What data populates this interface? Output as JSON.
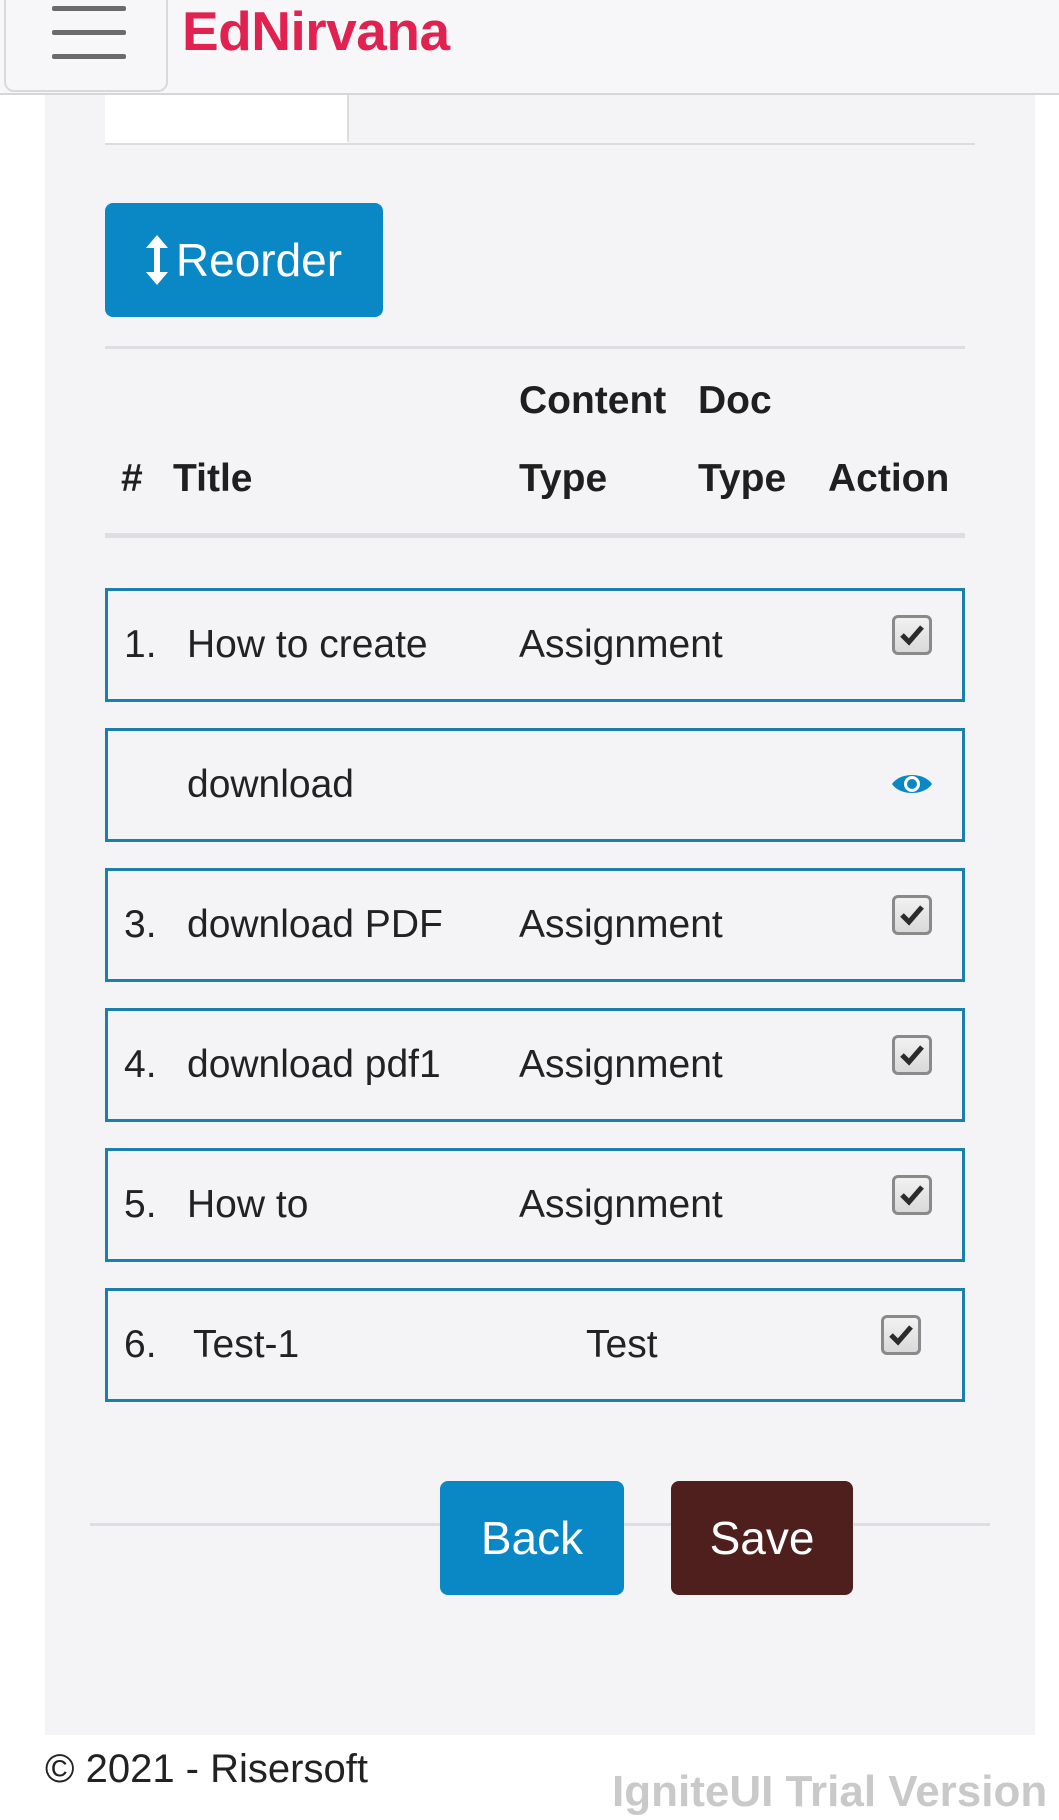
{
  "app": {
    "brand": "EdNirvana"
  },
  "toolbar": {
    "reorder_label": "Reorder"
  },
  "table": {
    "headers": {
      "number": "#",
      "title": "Title",
      "content_type_line1": "Content",
      "content_type_line2": "Type",
      "doc_type_line1": "Doc",
      "doc_type_line2": "Type",
      "action": "Action"
    },
    "rows": [
      {
        "number": "1.",
        "title": "How to create",
        "content_type": "Assignment",
        "checked": true
      },
      {
        "number": "",
        "title": "download",
        "content_type": "",
        "action_icon": "eye-icon"
      },
      {
        "number": "3.",
        "title": "download PDF",
        "content_type": "Assignment",
        "checked": true
      },
      {
        "number": "4.",
        "title": "download pdf1",
        "content_type": "Assignment",
        "checked": true
      },
      {
        "number": "5.",
        "title": "How to",
        "content_type": "Assignment",
        "checked": true
      },
      {
        "number": "6.",
        "title": "Test-1",
        "content_type": "Test",
        "checked": true
      }
    ]
  },
  "actions": {
    "back_label": "Back",
    "save_label": "Save"
  },
  "footer": {
    "copyright": "© 2021 - Risersoft",
    "watermark": "IgniteUI Trial Version"
  },
  "colors": {
    "brand": "#e1214f",
    "primary": "#0a88c6",
    "save": "#4f1f1e",
    "row_border": "#1a7fad"
  }
}
